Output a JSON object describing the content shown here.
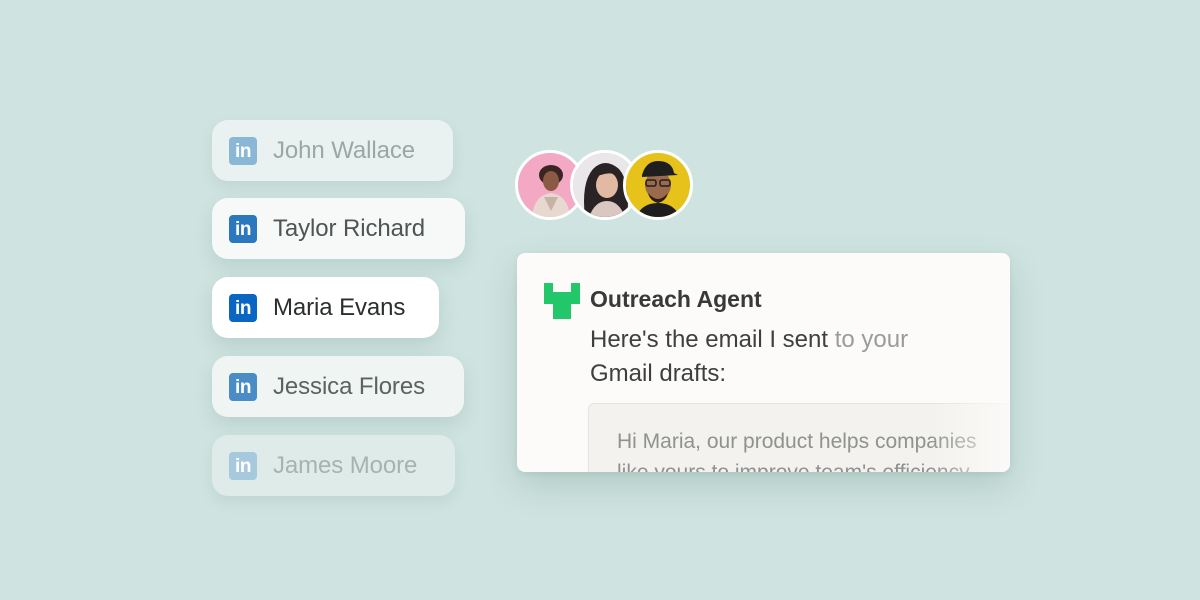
{
  "contacts": [
    {
      "name": "John Wallace",
      "icon": "linkedin-icon"
    },
    {
      "name": "Taylor Richard",
      "icon": "linkedin-icon"
    },
    {
      "name": "Maria Evans",
      "icon": "linkedin-icon"
    },
    {
      "name": "Jessica Flores",
      "icon": "linkedin-icon"
    },
    {
      "name": "James Moore",
      "icon": "linkedin-icon"
    }
  ],
  "linkedin_glyph": "in",
  "avatars": [
    {
      "bg": "#f3a9c4"
    },
    {
      "bg": "#e9e7ea"
    },
    {
      "bg": "#e7c21b"
    }
  ],
  "agent": {
    "name": "Outreach Agent",
    "logo_color": "#22c76a",
    "message_strong": "Here's the email I sent",
    "message_fade": " to your",
    "message_line2": "Gmail drafts:",
    "email_line1": "Hi Maria, our product helps companies",
    "email_line2": "like yours to improve team's efficiency"
  },
  "colors": {
    "background": "#cfe4e0",
    "linkedin": "#0a66c2"
  }
}
